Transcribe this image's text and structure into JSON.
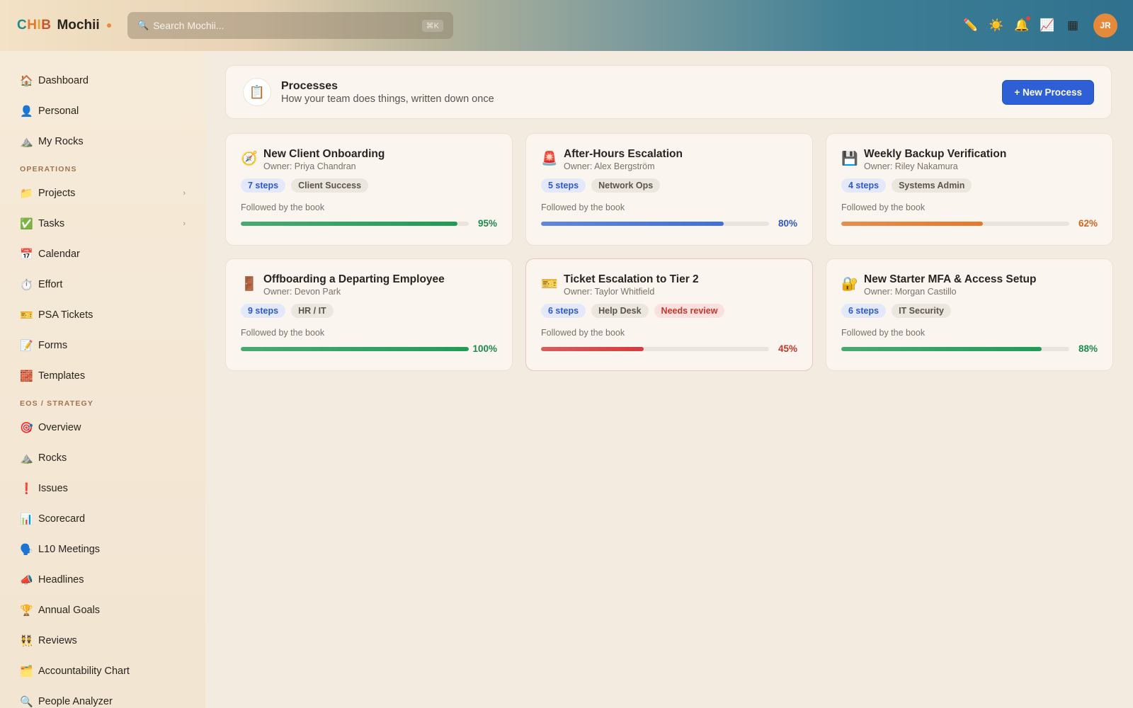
{
  "app": {
    "brand_word1": "CHIB",
    "brand_word2": "Mochii"
  },
  "search": {
    "placeholder": "Search Mochii...",
    "shortcut": "⌘K"
  },
  "header_icons": [
    "pencil-icon",
    "sun-icon",
    "bell-icon",
    "chart-icon",
    "grid-icon"
  ],
  "user": {
    "initials": "JR"
  },
  "sidebar": {
    "top_items": [
      {
        "icon": "🏠",
        "label": "Dashboard"
      },
      {
        "icon": "👤",
        "label": "Personal"
      },
      {
        "icon": "⛰️",
        "label": "My Rocks"
      }
    ],
    "operations_heading": "OPERATIONS",
    "operations_items": [
      {
        "icon": "📁",
        "label": "Projects",
        "chevron": "›"
      },
      {
        "icon": "✅",
        "label": "Tasks",
        "chevron": "›"
      },
      {
        "icon": "📅",
        "label": "Calendar"
      },
      {
        "icon": "⏱️",
        "label": "Effort"
      },
      {
        "icon": "🎫",
        "label": "PSA Tickets"
      },
      {
        "icon": "📝",
        "label": "Forms"
      },
      {
        "icon": "🧱",
        "label": "Templates"
      }
    ],
    "eos_heading": "EOS / STRATEGY",
    "eos_items": [
      {
        "icon": "🎯",
        "label": "Overview"
      },
      {
        "icon": "⛰️",
        "label": "Rocks"
      },
      {
        "icon": "❗",
        "label": "Issues"
      },
      {
        "icon": "📊",
        "label": "Scorecard"
      },
      {
        "icon": "🗣️",
        "label": "L10 Meetings"
      },
      {
        "icon": "📣",
        "label": "Headlines"
      },
      {
        "icon": "🏆",
        "label": "Annual Goals"
      },
      {
        "icon": "👯",
        "label": "Reviews"
      },
      {
        "icon": "🗂️",
        "label": "Accountability Chart"
      },
      {
        "icon": "🔍",
        "label": "People Analyzer"
      }
    ]
  },
  "page": {
    "icon": "📋",
    "title": "Processes",
    "subtitle": "How your team does things, written down once",
    "new_button": "+ New Process"
  },
  "processes": [
    {
      "icon": "🧭",
      "title": "New Client Onboarding",
      "owner": "Owner: Priya Chandran",
      "steps": "7 steps",
      "team": "Client Success",
      "label": "Followed by the book",
      "percent": 95,
      "percent_text": "95%",
      "bar_color": "#1f9d55",
      "pct_color": "#1f8a4c"
    },
    {
      "icon": "🚨",
      "title": "After-Hours Escalation",
      "owner": "Owner: Alex Bergström",
      "steps": "5 steps",
      "team": "Network Ops",
      "label": "Followed by the book",
      "percent": 80,
      "percent_text": "80%",
      "bar_color": "#3f6fde",
      "pct_color": "#2f58c9"
    },
    {
      "icon": "💾",
      "title": "Weekly Backup Verification",
      "owner": "Owner: Riley Nakamura",
      "steps": "4 steps",
      "team": "Systems Admin",
      "label": "Followed by the book",
      "percent": 62,
      "percent_text": "62%",
      "bar_color": "#e5782a",
      "pct_color": "#d0661f"
    },
    {
      "icon": "🚪",
      "title": "Offboarding a Departing Employee",
      "owner": "Owner: Devon Park",
      "steps": "9 steps",
      "team": "HR / IT",
      "label": "Followed by the book",
      "percent": 100,
      "percent_text": "100%",
      "bar_color": "#1f9d55",
      "pct_color": "#1f8a4c"
    },
    {
      "icon": "🎫",
      "title": "Ticket Escalation to Tier 2",
      "owner": "Owner: Taylor Whitfield",
      "steps": "6 steps",
      "team": "Help Desk",
      "review": "Needs review",
      "label": "Followed by the book",
      "percent": 45,
      "percent_text": "45%",
      "bar_color": "#d83b3b",
      "pct_color": "#c8362b"
    },
    {
      "icon": "🔐",
      "title": "New Starter MFA & Access Setup",
      "owner": "Owner: Morgan Castillo",
      "steps": "6 steps",
      "team": "IT Security",
      "label": "Followed by the book",
      "percent": 88,
      "percent_text": "88%",
      "bar_color": "#1f9d55",
      "pct_color": "#1f8a4c"
    }
  ]
}
